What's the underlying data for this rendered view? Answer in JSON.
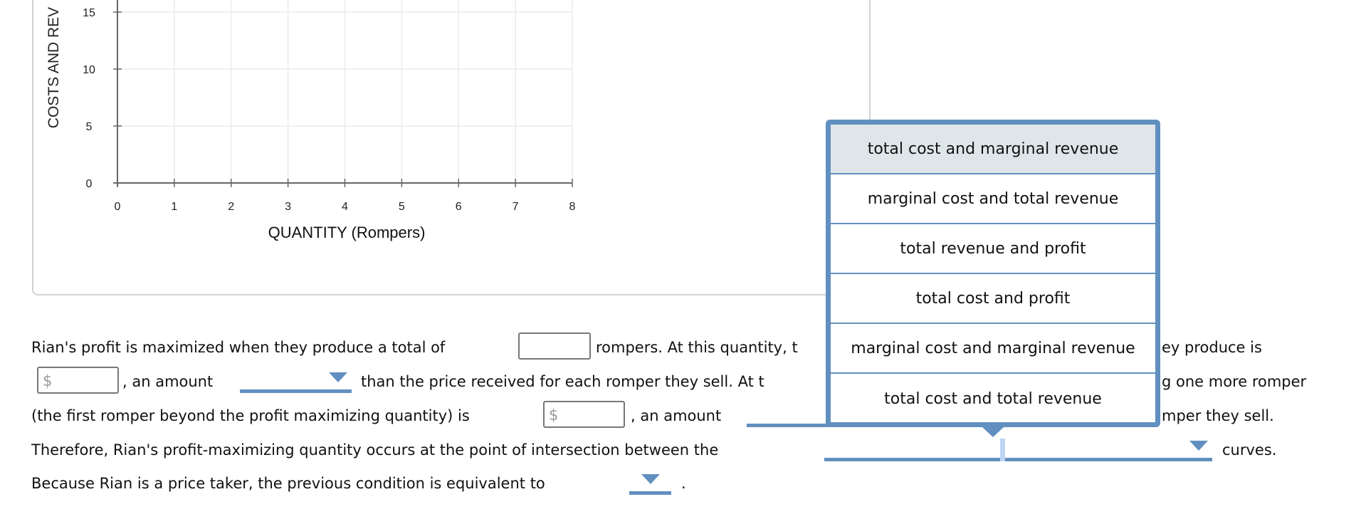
{
  "graph": {
    "y_axis_label": "COSTS AND REV",
    "x_axis_label": "QUANTITY (Rompers)",
    "x_ticks": [
      "0",
      "1",
      "2",
      "3",
      "4",
      "5",
      "6",
      "7",
      "8"
    ],
    "y_ticks": [
      "0",
      "5",
      "10",
      "15"
    ],
    "x_range": [
      0,
      8
    ],
    "y_range": [
      0,
      15
    ]
  },
  "question": {
    "l1_a": "Rian's profit is maximized when they produce a total of",
    "l1_b": "rompers. At this quantity, t",
    "l1_c": "ey produce is",
    "dollar": "$",
    "l2_a": ", an amount",
    "l2_b": "than the price received for each romper they sell. At t",
    "l2_c": "g one more romper",
    "l3_a": "(the first romper beyond the profit maximizing quantity) is",
    "l3_b": ", an amount",
    "l3_c": "mper they sell.",
    "l4_a": "Therefore, Rian's profit-maximizing quantity occurs at the point of intersection between the",
    "l4_b": "curves.",
    "l5_a": "Because Rian is a price taker, the previous condition is equivalent to",
    "l5_b": "."
  },
  "dropdown_options": [
    "total cost and marginal revenue",
    "marginal cost and total revenue",
    "total revenue and profit",
    "total cost and profit",
    "marginal cost and marginal revenue",
    "total cost and total revenue"
  ],
  "colors": {
    "accent": "#6190c0",
    "highlight": "#dfe6e9"
  }
}
